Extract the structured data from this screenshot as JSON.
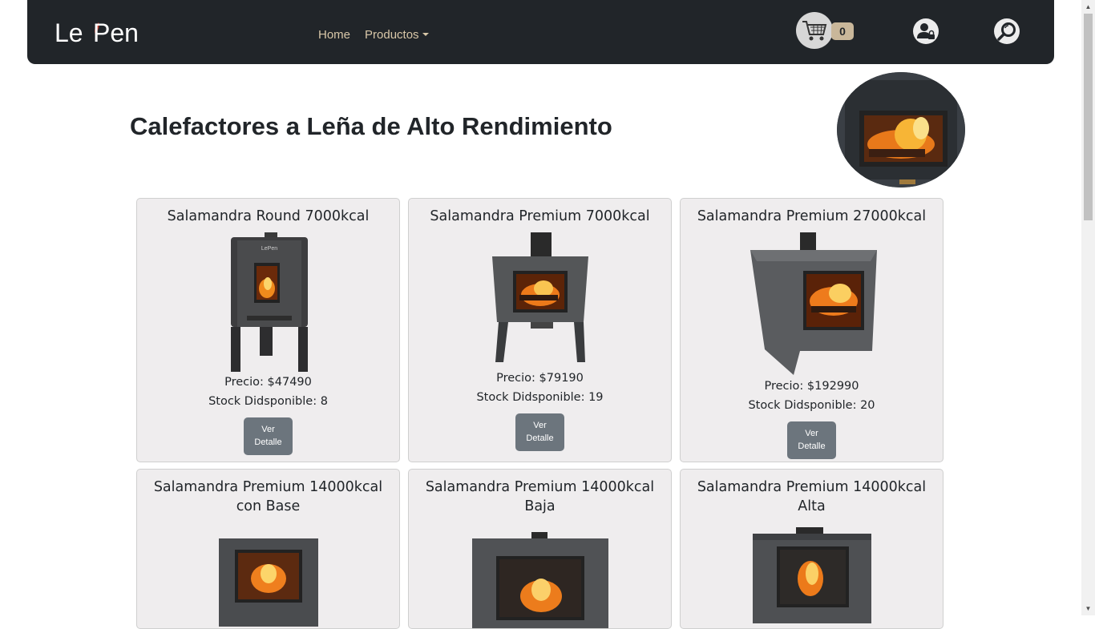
{
  "nav": {
    "brand": "LePen",
    "links": [
      "Home",
      "Productos"
    ],
    "cart_count": "0"
  },
  "page": {
    "title": "Calefactores a Leña de Alto Rendimiento"
  },
  "products": [
    {
      "name": "Salamandra Round 7000kcal",
      "price": "Precio: $47490",
      "stock": "Stock Didsponible: 8",
      "button": "Ver Detalle"
    },
    {
      "name": "Salamandra Premium 7000kcal",
      "price": "Precio: $79190",
      "stock": "Stock Didsponible: 19",
      "button": "Ver Detalle"
    },
    {
      "name": "Salamandra Premium 27000kcal",
      "price": "Precio: $192990",
      "stock": "Stock Didsponible: 20",
      "button": "Ver Detalle"
    },
    {
      "name": "Salamandra Premium 14000kcal con Base"
    },
    {
      "name": "Salamandra Premium 14000kcal Baja"
    },
    {
      "name": "Salamandra Premium 14000kcal Alta"
    }
  ],
  "colors": {
    "navbar": "#212529",
    "nav_link": "#d8c7a8",
    "card_bg": "#efedee",
    "button": "#6c757d"
  }
}
